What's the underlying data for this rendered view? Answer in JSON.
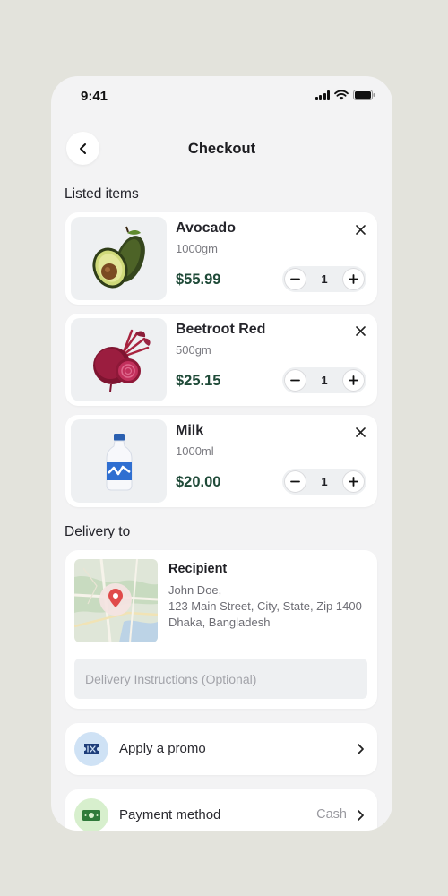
{
  "status_bar": {
    "time": "9:41"
  },
  "header": {
    "title": "Checkout"
  },
  "sections": {
    "listed_items": "Listed items",
    "delivery_to": "Delivery to"
  },
  "items": [
    {
      "name": "Avocado",
      "quantity_unit": "1000gm",
      "price": "$55.99",
      "count": "1",
      "icon": "avocado-image"
    },
    {
      "name": "Beetroot Red",
      "quantity_unit": "500gm",
      "price": "$25.15",
      "count": "1",
      "icon": "beetroot-image"
    },
    {
      "name": "Milk",
      "quantity_unit": "1000ml",
      "price": "$20.00",
      "count": "1",
      "icon": "milk-bottle-image"
    }
  ],
  "delivery": {
    "title": "Recipient",
    "name_line": "John Doe,",
    "address_line1": "123 Main Street, City, State,  Zip 1400",
    "address_line2": "Dhaka, Bangladesh",
    "instructions_placeholder": "Delivery Instructions (Optional)"
  },
  "promo": {
    "label": "Apply a promo",
    "icon": "ticket-icon"
  },
  "payment": {
    "label": "Payment method",
    "value": "Cash",
    "icon": "cash-icon"
  },
  "colors": {
    "background": "#e3e3dc",
    "screen": "#f3f3f4",
    "price": "#1f4a38",
    "promo_icon_bg": "#cfe2f5",
    "payment_icon_bg": "#d7efcd"
  }
}
